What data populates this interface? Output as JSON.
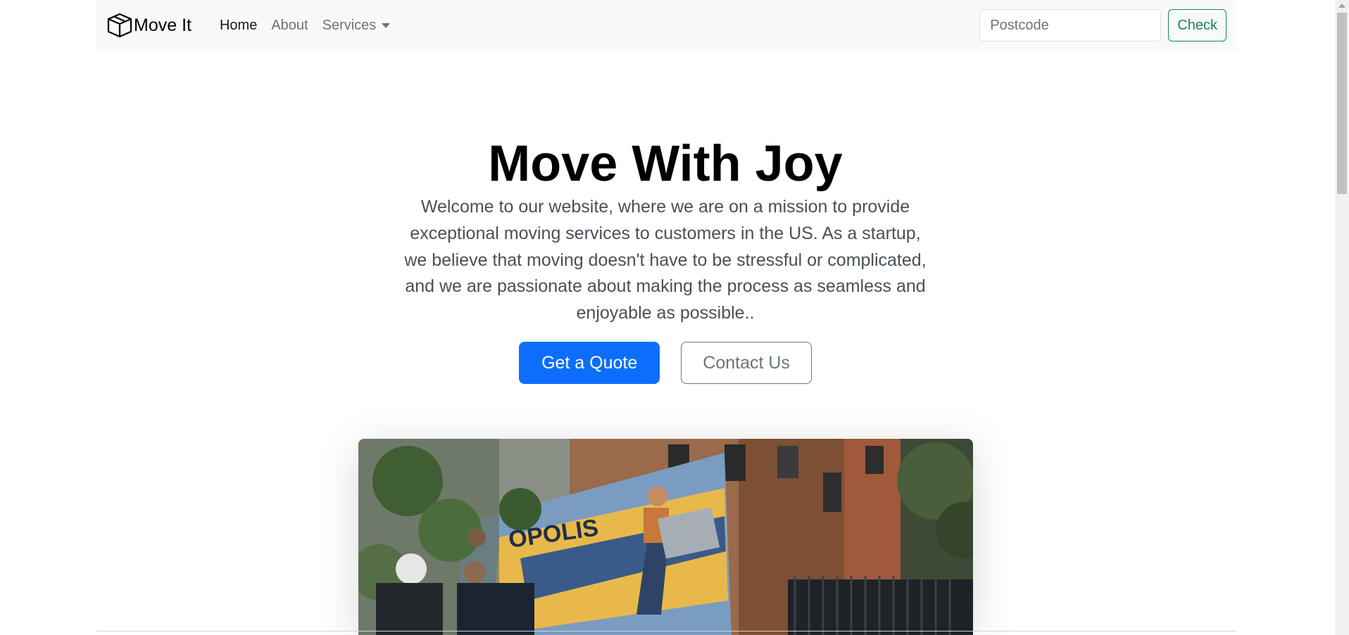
{
  "navbar": {
    "brand_name": "Move It",
    "brand_icon": "box-icon",
    "links": [
      {
        "label": "Home",
        "active": true
      },
      {
        "label": "About",
        "active": false
      },
      {
        "label": "Services",
        "active": false,
        "dropdown": true
      }
    ],
    "postcode_placeholder": "Postcode",
    "check_label": "Check"
  },
  "hero": {
    "title": "Move With Joy",
    "lead": "Welcome to our website, where we are on a mission to provide exceptional moving services to customers in the US. As a startup, we believe that moving doesn't have to be stressful or complicated, and we are passionate about making the process as seamless and enjoyable as possible..",
    "primary_button": "Get a Quote",
    "secondary_button": "Contact Us",
    "image_subject": "moving-truck-photo"
  },
  "colors": {
    "primary": "#0d6efd",
    "success": "#198754",
    "secondary": "#6c757d",
    "navbar_bg": "#f8f9fa"
  }
}
